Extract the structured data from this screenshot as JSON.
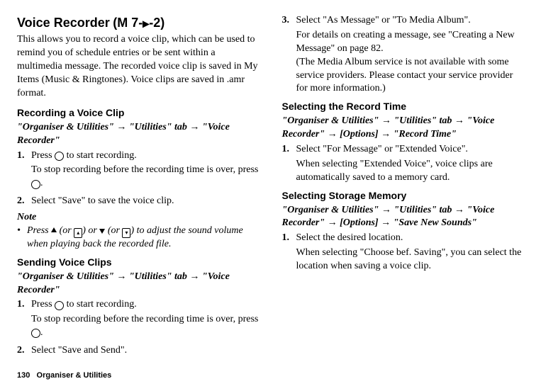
{
  "title": {
    "main": "Voice Recorder",
    "code_prefix": "(M 7-",
    "code_suffix": "-2)"
  },
  "intro": "This allows you to record a voice clip, which can be used to remind you of schedule entries or be sent within a multimedia message. The recorded voice clip is saved in My Items (Music & Ringtones). Voice clips are saved in .amr format.",
  "sec1": {
    "head": "Recording a Voice Clip",
    "path": "\"Organiser & Utilities\" → \"Utilities\" tab → \"Voice Recorder\"",
    "step1_num": "1.",
    "step1_a": "Press ",
    "step1_b": " to start recording.",
    "step1_detail_a": "To stop recording before the recording time is over, press ",
    "step1_detail_b": ".",
    "step2_num": "2.",
    "step2": "Select \"Save\" to save the voice clip."
  },
  "note": {
    "label": "Note",
    "bullet": "•",
    "a": "Press ",
    "b": " (or ",
    "c": ") or ",
    "d": " (or ",
    "e": ") to adjust the sound volume when playing back the recorded file."
  },
  "sec2": {
    "head": "Sending Voice Clips",
    "path": "\"Organiser & Utilities\" → \"Utilities\" tab → \"Voice Recorder\"",
    "step1_num": "1.",
    "step1_a": "Press ",
    "step1_b": " to start recording.",
    "step1_detail_a": "To stop recording before the recording time is over, press ",
    "step1_detail_b": ".",
    "step2_num": "2.",
    "step2": "Select \"Save and Send\".",
    "step3_num": "3.",
    "step3": "Select \"As Message\" or \"To Media Album\".",
    "step3_detail": "For details on creating a message, see \"Creating a New Message\" on page 82.\n(The Media Album service is not available with some service providers. Please contact your service provider for more information.)"
  },
  "sec3": {
    "head": "Selecting the Record Time",
    "path": "\"Organiser & Utilities\" → \"Utilities\" tab → \"Voice Recorder\" → [Options] → \"Record Time\"",
    "step1_num": "1.",
    "step1": "Select \"For Message\" or \"Extended Voice\".",
    "step1_detail": "When selecting \"Extended Voice\", voice clips are automatically saved to a memory card."
  },
  "sec4": {
    "head": "Selecting Storage Memory",
    "path": "\"Organiser & Utilities\" → \"Utilities\" tab → \"Voice Recorder\" → [Options] → \"Save New Sounds\"",
    "step1_num": "1.",
    "step1": "Select the desired location.",
    "step1_detail": "When selecting \"Choose bef. Saving\", you can select the location when saving a voice clip."
  },
  "footer": {
    "page": "130",
    "section": "Organiser & Utilities"
  }
}
